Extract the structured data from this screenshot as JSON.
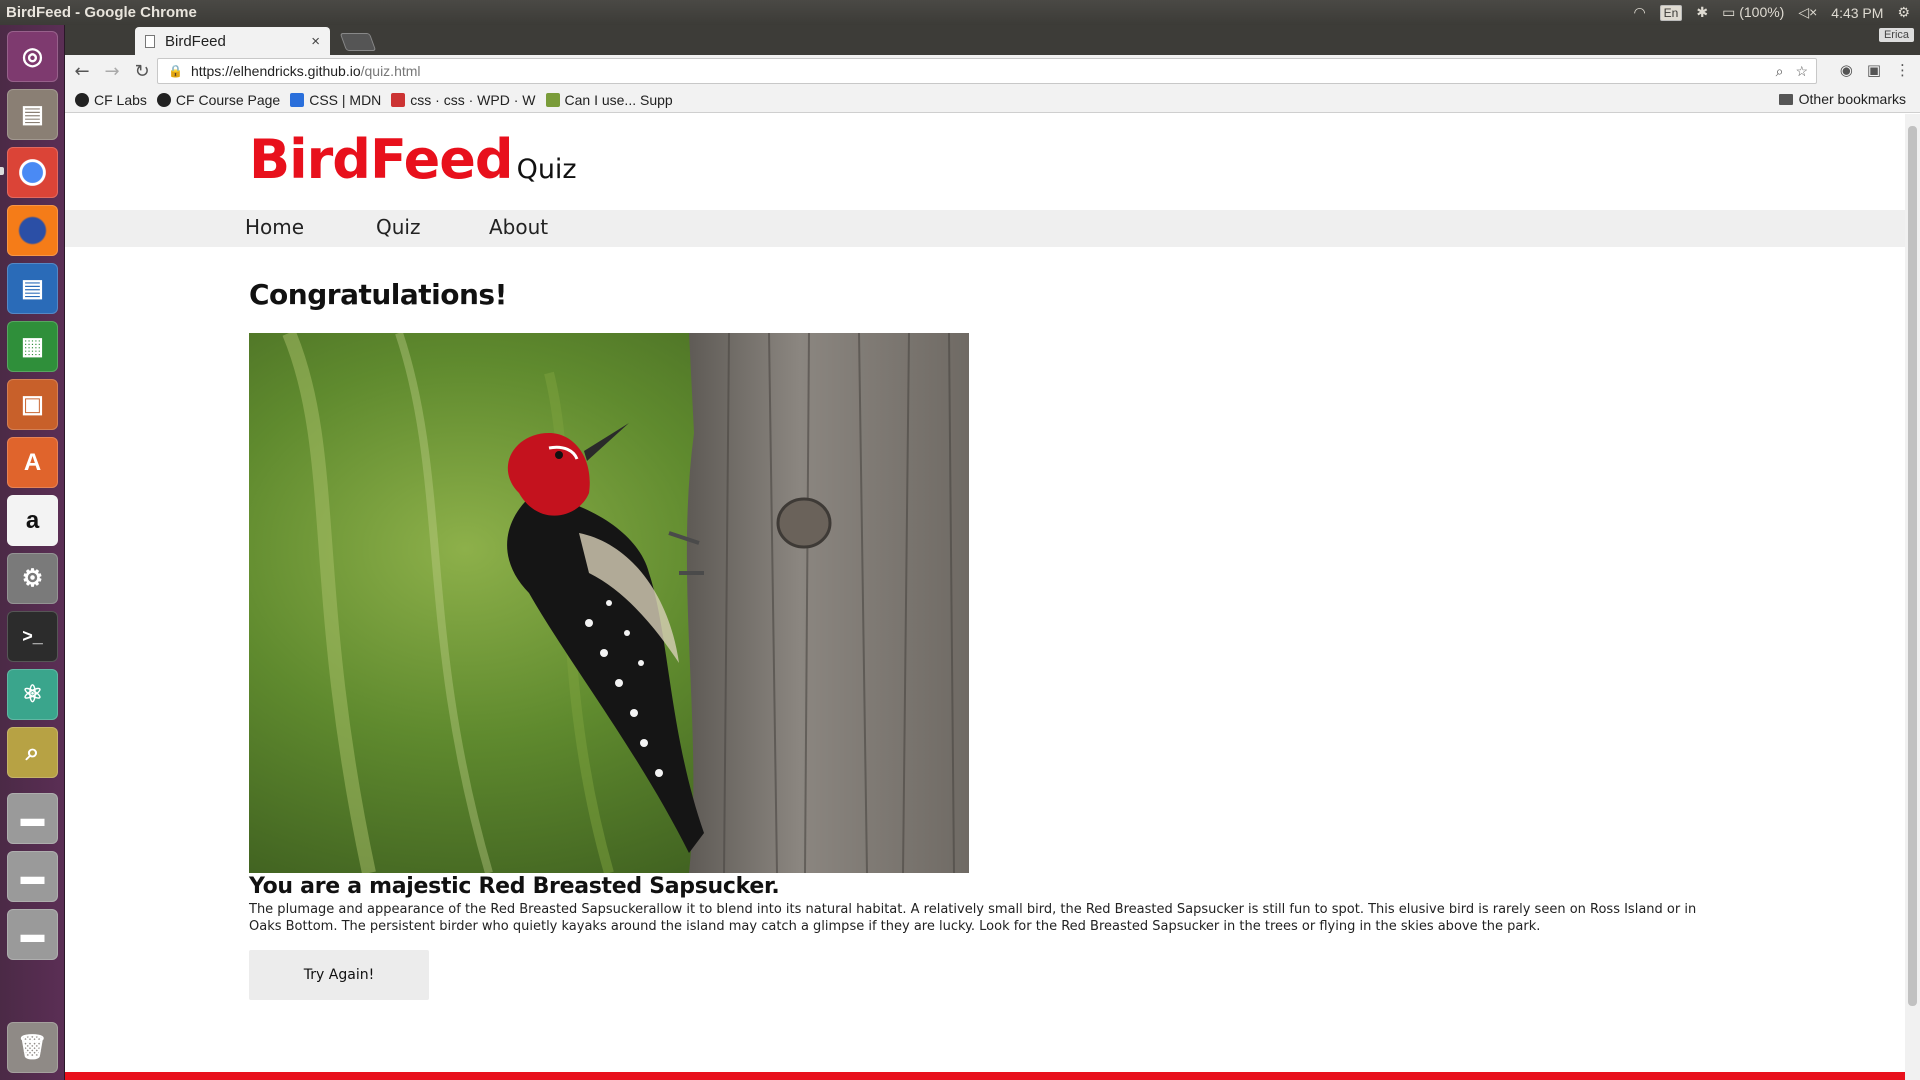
{
  "os_panel": {
    "window_title": "BirdFeed - Google Chrome",
    "keyboard": "En",
    "battery": "(100%)",
    "clock": "4:43 PM"
  },
  "launcher": {
    "items": [
      "ubuntu-dash",
      "files",
      "chrome",
      "firefox",
      "writer",
      "calc",
      "impress",
      "software-center",
      "amazon",
      "system-settings",
      "terminal",
      "atom",
      "image-viewer",
      "drive-1",
      "drive-2",
      "drive-3",
      "trash"
    ]
  },
  "browser": {
    "tab_title": "BirdFeed",
    "tab_close": "×",
    "profile": "Erica",
    "url_host": "https://elhendricks.github.io",
    "url_path": "/quiz.html",
    "bookmarks": [
      {
        "label": "CF Labs"
      },
      {
        "label": "CF Course Page"
      },
      {
        "label": "CSS | MDN"
      },
      {
        "label": "css · css · WPD · W"
      },
      {
        "label": "Can I use... Supp"
      }
    ],
    "other_bookmarks": "Other bookmarks"
  },
  "page": {
    "logo": "BirdFeed",
    "logo_sub": "Quiz",
    "nav": [
      {
        "label": "Home"
      },
      {
        "label": "Quiz"
      },
      {
        "label": "About"
      }
    ],
    "headline": "Congratulations!",
    "result_title": "You are a majestic Red Breasted Sapsucker.",
    "result_text": "The plumage and appearance of the Red Breasted Sapsuckerallow it to blend into its natural habitat. A relatively small bird, the Red Breasted Sapsucker is still fun to spot. This elusive bird is rarely seen on Ross Island or in Oaks Bottom. The persistent birder who quietly kayaks around the island may catch a glimpse if they are lucky. Look for the Red Breasted Sapsucker in the trees or flying in the skies above the park.",
    "try_again": "Try Again!",
    "colors": {
      "brand": "#e8101c",
      "nav_bg": "#efefef"
    }
  }
}
